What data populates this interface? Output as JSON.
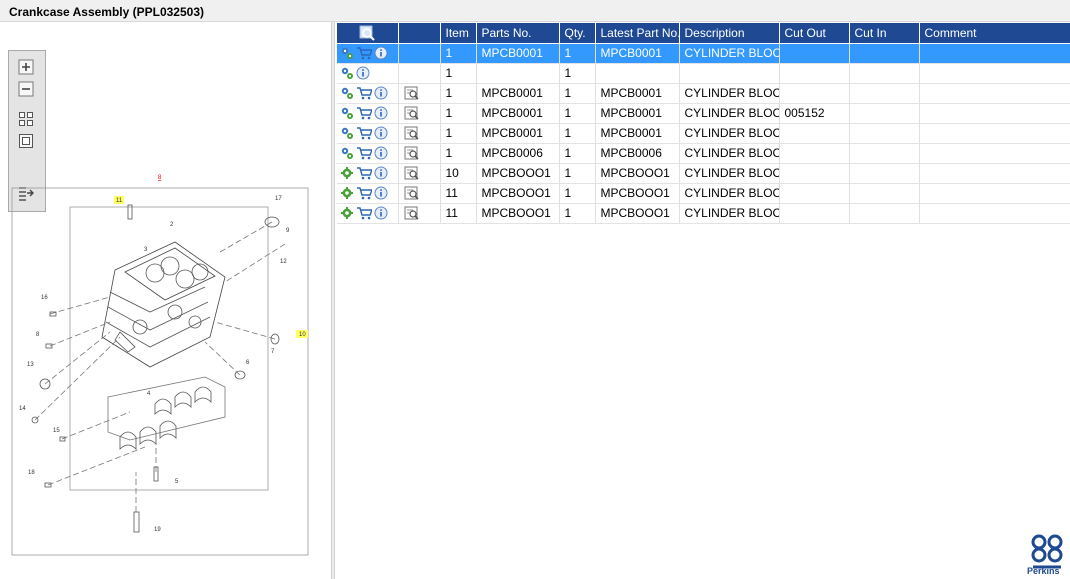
{
  "window": {
    "title": "Crankcase Assembly (PPL032503)"
  },
  "zoom_toolbar": {
    "buttons": [
      "zoom-in",
      "zoom-out",
      "fit-all",
      "fit-window",
      "show-list"
    ]
  },
  "drawing": {
    "callouts": [
      "8",
      "11",
      "17",
      "2",
      "9",
      "3",
      "12",
      "16",
      "10",
      "8",
      "7",
      "6",
      "13",
      "4",
      "14",
      "15",
      "5",
      "18",
      "19"
    ]
  },
  "grid": {
    "columns": [
      "",
      "",
      "Item",
      "Parts No.",
      "Qty.",
      "Latest Part No.",
      "Description",
      "Cut Out",
      "Cut In",
      "Comment"
    ],
    "rows": [
      {
        "selected": true,
        "icon1": "gears-icon",
        "cart": true,
        "item": "1",
        "part": "MPCB0001",
        "qty": "1",
        "latest": "MPCB0001",
        "desc": "CYLINDER BLOCK K",
        "cut_out": "",
        "cut_in": "",
        "comment": "",
        "drawing": false
      },
      {
        "selected": false,
        "icon1": "gears-icon",
        "cart": false,
        "item": "1",
        "part": "",
        "qty": "1",
        "latest": "",
        "desc": "",
        "cut_out": "",
        "cut_in": "",
        "comment": "",
        "drawing": false
      },
      {
        "selected": false,
        "icon1": "gears-icon",
        "cart": true,
        "item": "1",
        "part": "MPCB0001",
        "qty": "1",
        "latest": "MPCB0001",
        "desc": "CYLINDER BLOCK K",
        "cut_out": "",
        "cut_in": "",
        "comment": "",
        "drawing": true
      },
      {
        "selected": false,
        "icon1": "gears-icon",
        "cart": true,
        "item": "1",
        "part": "MPCB0001",
        "qty": "1",
        "latest": "MPCB0001",
        "desc": "CYLINDER BLOCK K",
        "cut_out": "005152",
        "cut_in": "",
        "comment": "",
        "drawing": true
      },
      {
        "selected": false,
        "icon1": "gears-icon",
        "cart": true,
        "item": "1",
        "part": "MPCB0001",
        "qty": "1",
        "latest": "MPCB0001",
        "desc": "CYLINDER BLOCK K",
        "cut_out": "",
        "cut_in": "",
        "comment": "",
        "drawing": true
      },
      {
        "selected": false,
        "icon1": "gears-icon",
        "cart": true,
        "item": "1",
        "part": "MPCB0006",
        "qty": "1",
        "latest": "MPCB0006",
        "desc": "CYLINDER BLOCK K",
        "cut_out": "",
        "cut_in": "",
        "comment": "",
        "drawing": true
      },
      {
        "selected": false,
        "icon1": "gear-icon",
        "cart": true,
        "item": "10",
        "part": "MPCBOOO1",
        "qty": "1",
        "latest": "MPCBOOO1",
        "desc": "CYLINDER BLOCK K",
        "cut_out": "",
        "cut_in": "",
        "comment": "",
        "drawing": true
      },
      {
        "selected": false,
        "icon1": "gear-icon",
        "cart": true,
        "item": "11",
        "part": "MPCBOOO1",
        "qty": "1",
        "latest": "MPCBOOO1",
        "desc": "CYLINDER BLOCK K",
        "cut_out": "",
        "cut_in": "",
        "comment": "",
        "drawing": true
      },
      {
        "selected": false,
        "icon1": "gear-icon",
        "cart": true,
        "item": "11",
        "part": "MPCBOOO1",
        "qty": "1",
        "latest": "MPCBOOO1",
        "desc": "CYLINDER BLOCK K",
        "cut_out": "",
        "cut_in": "",
        "comment": "",
        "drawing": true
      }
    ]
  },
  "brand": {
    "name": "Perkins",
    "color": "#1f4a93"
  },
  "colors": {
    "header_bg": "#1f4a93",
    "selected_row": "#3399ff",
    "callout_highlight": "#ffff66",
    "callout_red": "#d40000"
  }
}
